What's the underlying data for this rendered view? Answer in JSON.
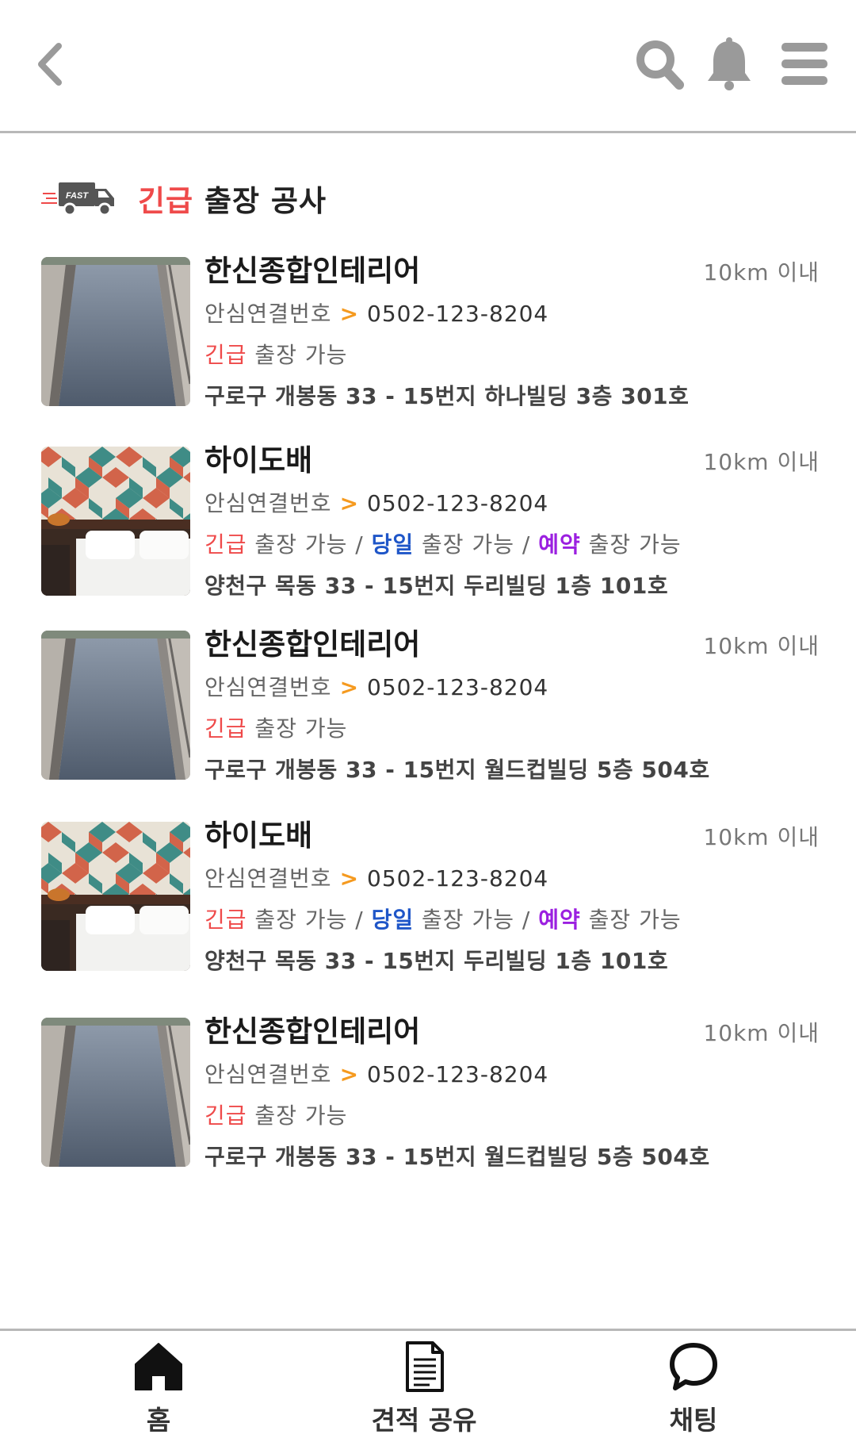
{
  "header": {
    "back_icon": "chevron-left-icon",
    "search_icon": "search-icon",
    "bell_icon": "bell-icon",
    "menu_icon": "hamburger-menu-icon"
  },
  "section": {
    "icon": "fast-truck-icon",
    "truck_text": "FAST",
    "title_urgent": "긴급",
    "title_rest": " 출장 공사"
  },
  "labels": {
    "phone_prefix": "안심연결번호",
    "arrow": ">",
    "urgent": "긴급",
    "same_day": "당일",
    "reserve": "예약",
    "possible": " 출장 가능",
    "sep": " / "
  },
  "listings": [
    {
      "name": "한신종합인테리어",
      "distance": "10km 이내",
      "phone": "0502-123-8204",
      "image": "balcony",
      "tags": [
        "urgent"
      ],
      "address": "구로구 개봉동 33 - 15번지 하나빌딩 3층 301호"
    },
    {
      "name": "하이도배",
      "distance": "10km 이내",
      "phone": "0502-123-8204",
      "image": "bedroom",
      "tags": [
        "urgent",
        "same_day",
        "reserve"
      ],
      "address": "양천구 목동 33 - 15번지 두리빌딩 1층 101호"
    },
    {
      "name": "한신종합인테리어",
      "distance": "10km 이내",
      "phone": "0502-123-8204",
      "image": "balcony",
      "tags": [
        "urgent"
      ],
      "address": "구로구 개봉동 33 - 15번지 월드컵빌딩 5층 504호"
    },
    {
      "name": "하이도배",
      "distance": "10km 이내",
      "phone": "0502-123-8204",
      "image": "bedroom",
      "tags": [
        "urgent",
        "same_day",
        "reserve"
      ],
      "address": "양천구 목동 33 - 15번지 두리빌딩 1층 101호"
    },
    {
      "name": "한신종합인테리어",
      "distance": "10km 이내",
      "phone": "0502-123-8204",
      "image": "balcony",
      "tags": [
        "urgent"
      ],
      "address": "구로구 개봉동 33 - 15번지 월드컵빌딩 5층 504호"
    }
  ],
  "bottom_nav": [
    {
      "label": "홈",
      "icon": "home-icon"
    },
    {
      "label": "견적 공유",
      "icon": "document-icon"
    },
    {
      "label": "채팅",
      "icon": "chat-bubble-icon"
    }
  ],
  "colors": {
    "urgent_red": "#ef4a4a",
    "same_day_blue": "#1f56c8",
    "reserve_purple": "#9b1fe0",
    "arrow_orange": "#f59a1f",
    "icon_gray": "#9a9a9a"
  }
}
